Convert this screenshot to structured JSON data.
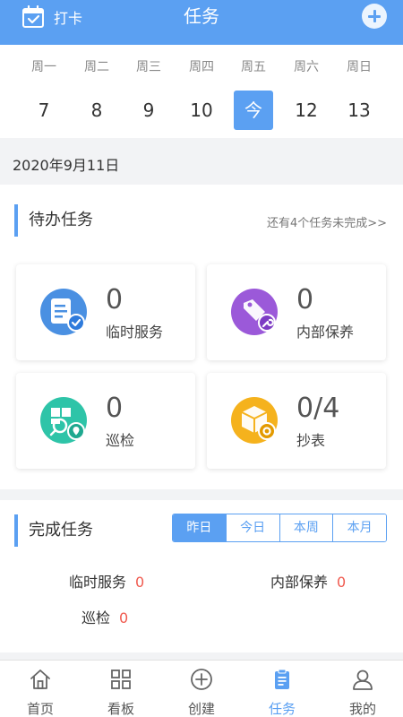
{
  "header": {
    "checkin_label": "打卡",
    "title": "任务",
    "checkin_icon": "calendar-check-icon",
    "add_icon": "plus-circle-icon"
  },
  "week": {
    "days": [
      {
        "weekday": "周一",
        "date": "7"
      },
      {
        "weekday": "周二",
        "date": "8"
      },
      {
        "weekday": "周三",
        "date": "9"
      },
      {
        "weekday": "周四",
        "date": "10"
      },
      {
        "weekday": "周五",
        "date": "今"
      },
      {
        "weekday": "周六",
        "date": "12"
      },
      {
        "weekday": "周日",
        "date": "13"
      }
    ],
    "selected_index": 4
  },
  "date_label": "2020年9月11日",
  "pending": {
    "title": "待办任务",
    "more_link": "还有4个任务未完成>>",
    "cards": [
      {
        "count": "0",
        "label": "临时服务",
        "icon": "document-check-icon",
        "color": "#4a90e2"
      },
      {
        "count": "0",
        "label": "内部保养",
        "icon": "tag-wrench-icon",
        "color": "#9b59d9"
      },
      {
        "count": "0",
        "label": "巡检",
        "icon": "inspection-location-icon",
        "color": "#2ec4a8"
      },
      {
        "count": "0/4",
        "label": "抄表",
        "icon": "box-gear-icon",
        "color": "#f5b21d"
      }
    ]
  },
  "completed": {
    "title": "完成任务",
    "tabs": [
      "昨日",
      "今日",
      "本周",
      "本月"
    ],
    "active_tab": 0,
    "stats": [
      {
        "label": "临时服务",
        "value": "0"
      },
      {
        "label": "内部保养",
        "value": "0"
      },
      {
        "label": "巡检",
        "value": "0"
      }
    ]
  },
  "tabbar": {
    "items": [
      {
        "label": "首页",
        "icon": "home-icon"
      },
      {
        "label": "看板",
        "icon": "grid-icon"
      },
      {
        "label": "创建",
        "icon": "plus-circle-outline-icon"
      },
      {
        "label": "任务",
        "icon": "clipboard-icon"
      },
      {
        "label": "我的",
        "icon": "user-icon"
      }
    ],
    "active_index": 3
  },
  "colors": {
    "primary": "#5ba0f2",
    "value_red": "#f05a4f",
    "background": "#f2f3f5"
  }
}
